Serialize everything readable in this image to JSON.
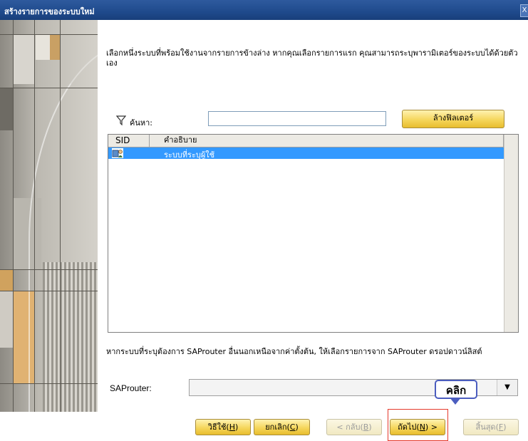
{
  "window": {
    "title": "สร้างรายการของระบบใหม่",
    "close_glyph": "X"
  },
  "content": {
    "description": "เลือกหนึ่งระบบที่พร้อมใช้งานจากรายการข้างล่าง หากคุณเลือกรายการแรก คุณสามารถระบุพารามิเตอร์ของระบบได้ด้วยตัวเอง",
    "search": {
      "label": "ค้นหา:",
      "value": "",
      "icon": "filter-funnel-icon"
    },
    "clear_filter_label": "ล้างฟิลเตอร์",
    "list": {
      "columns": [
        "SID",
        "คำอธิบาย"
      ],
      "rows": [
        {
          "sid": "",
          "description": "ระบบที่ระบุผู้ใช้",
          "icon": "user-defined-system-icon",
          "selected": true
        }
      ]
    },
    "saprouter_note": "หากระบบที่ระบุต้องการ SAProuter อื่นนอกเหนือจากค่าตั้งต้น, ให้เลือกรายการจาก SAProuter ดรอปดาวน์ลิสต์",
    "saprouter": {
      "label": "SAProuter:",
      "value": ""
    },
    "callout": "คลิก"
  },
  "footer": {
    "help": {
      "label": "วิธีใช้",
      "key": "H"
    },
    "cancel": {
      "label": "ยกเลิก",
      "key": "C"
    },
    "back": {
      "prefix": "< กลับ",
      "key": "B"
    },
    "next": {
      "label": "ถัดไป",
      "key": "N",
      "suffix": " >"
    },
    "finish": {
      "label": "สิ้นสุด",
      "key": "F"
    }
  },
  "colors": {
    "titlebar": "#1f4a8c",
    "selection": "#3399ff",
    "button": "#f5d65c",
    "highlight": "#e5392b",
    "callout_border": "#4b5dbf"
  }
}
